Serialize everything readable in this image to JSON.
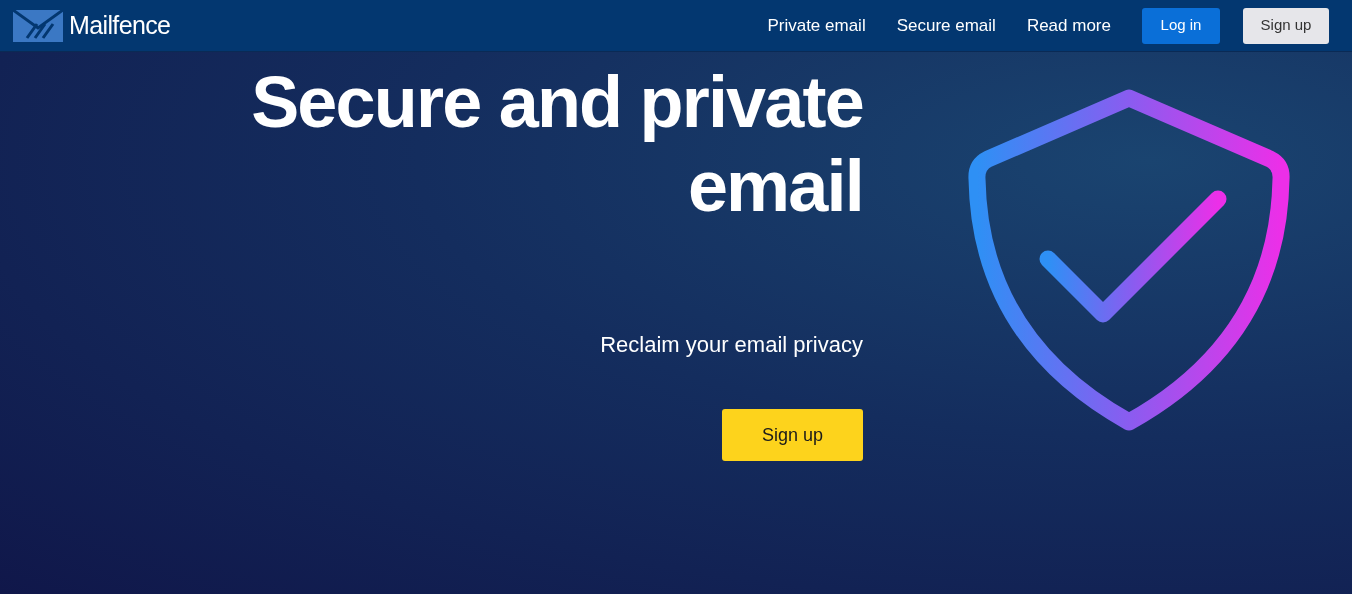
{
  "header": {
    "logo": "Mailfence",
    "nav": [
      {
        "label": "Private email"
      },
      {
        "label": "Secure email"
      },
      {
        "label": "Read more"
      }
    ],
    "login": "Log in",
    "signup": "Sign up"
  },
  "hero": {
    "title_lines": [
      "Secure and private",
      "email"
    ],
    "subtitle": "Reclaim your email privacy",
    "cta": "Sign up"
  }
}
